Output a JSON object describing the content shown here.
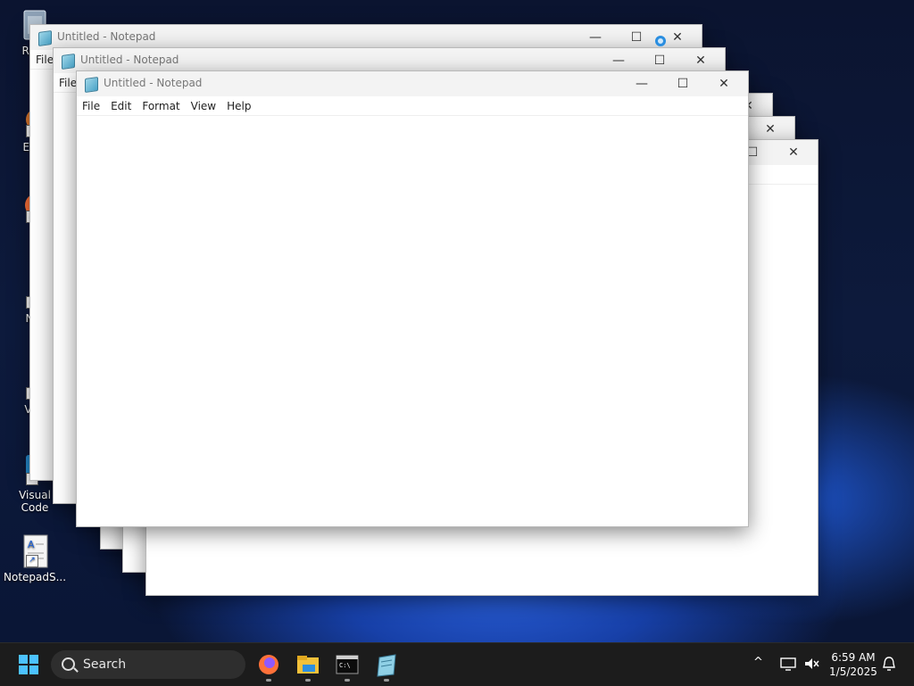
{
  "desktop": {
    "icons": [
      {
        "label": "Recy",
        "icon": "recycle-bin-icon"
      },
      {
        "label": "Ever",
        "icon": "everything-icon"
      },
      {
        "label": "Fi",
        "icon": "firefox-icon"
      },
      {
        "label": "Not",
        "icon": "notepad-plus-icon"
      },
      {
        "label": "VLC",
        "icon": "vlc-icon"
      },
      {
        "label": "Visual Code",
        "icon": "vscode-icon"
      },
      {
        "label": "NotepadS...",
        "icon": "notepad-shortcut-icon"
      }
    ]
  },
  "windows": [
    {
      "title": "Untitled - Notepad",
      "menu_partial": "File"
    },
    {
      "title": "Untitled - Notepad",
      "menu_partial": "File"
    },
    {
      "title": "Untitled - Notepad",
      "menu": [
        "File",
        "Edit",
        "Format",
        "View",
        "Help"
      ]
    }
  ],
  "controls": {
    "minimize": "—",
    "maximize": "☐",
    "close": "✕"
  },
  "taskbar": {
    "search_placeholder": "Search",
    "apps": [
      "start-icon",
      "firefox-icon",
      "file-explorer-icon",
      "terminal-icon",
      "notepad-icon"
    ],
    "tray": {
      "chevron": "^",
      "time": "6:59 AM",
      "date": "1/5/2025"
    }
  },
  "colors": {
    "accent": "#0a5fd8",
    "taskbar": "#1c1c1c",
    "titlebar": "#f3f3f3"
  }
}
